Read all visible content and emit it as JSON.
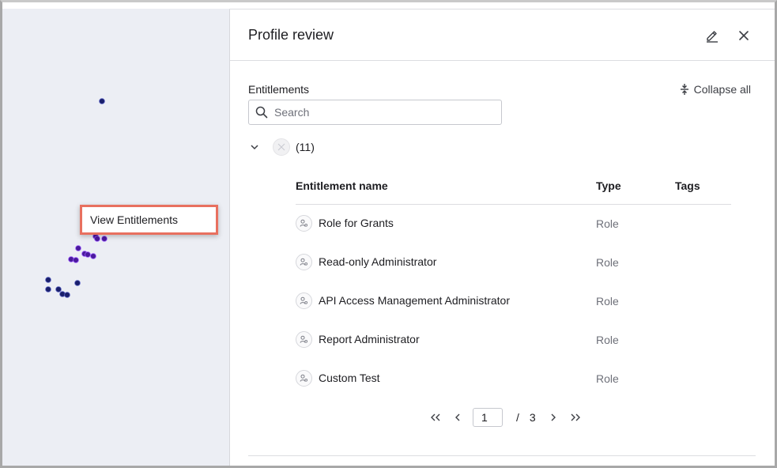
{
  "graph": {
    "context_menu": {
      "label": "View Entitlements"
    },
    "colors": {
      "node": "#1a1f6b",
      "node_highlight": "#4a1a9c",
      "background": "#eceef4"
    }
  },
  "panel": {
    "title": "Profile review",
    "edit_icon": "pencil-icon",
    "close_icon": "close-icon"
  },
  "entitlements": {
    "section_label": "Entitlements",
    "collapse_all_label": "Collapse all",
    "search": {
      "placeholder": "Search",
      "value": ""
    },
    "group": {
      "count_label": "(11)"
    },
    "columns": {
      "name": "Entitlement name",
      "type": "Type",
      "tags": "Tags"
    },
    "rows": [
      {
        "name": "Role for Grants",
        "type": "Role",
        "tags": ""
      },
      {
        "name": "Read-only Administrator",
        "type": "Role",
        "tags": ""
      },
      {
        "name": "API Access Management Administrator",
        "type": "Role",
        "tags": ""
      },
      {
        "name": "Report Administrator",
        "type": "Role",
        "tags": ""
      },
      {
        "name": "Custom Test",
        "type": "Role",
        "tags": ""
      }
    ],
    "pagination": {
      "current_page": "1",
      "separator": "/",
      "total_pages": "3"
    }
  }
}
